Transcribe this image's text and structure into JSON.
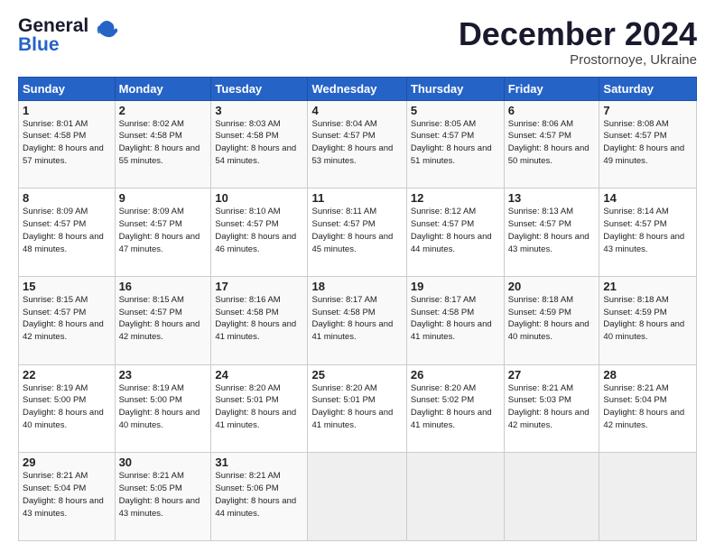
{
  "logo": {
    "line1": "General",
    "line2": "Blue"
  },
  "title": "December 2024",
  "location": "Prostornoye, Ukraine",
  "header_days": [
    "Sunday",
    "Monday",
    "Tuesday",
    "Wednesday",
    "Thursday",
    "Friday",
    "Saturday"
  ],
  "weeks": [
    [
      {
        "day": "1",
        "sunrise": "8:01 AM",
        "sunset": "4:58 PM",
        "daylight": "8 hours and 57 minutes."
      },
      {
        "day": "2",
        "sunrise": "8:02 AM",
        "sunset": "4:58 PM",
        "daylight": "8 hours and 55 minutes."
      },
      {
        "day": "3",
        "sunrise": "8:03 AM",
        "sunset": "4:58 PM",
        "daylight": "8 hours and 54 minutes."
      },
      {
        "day": "4",
        "sunrise": "8:04 AM",
        "sunset": "4:57 PM",
        "daylight": "8 hours and 53 minutes."
      },
      {
        "day": "5",
        "sunrise": "8:05 AM",
        "sunset": "4:57 PM",
        "daylight": "8 hours and 51 minutes."
      },
      {
        "day": "6",
        "sunrise": "8:06 AM",
        "sunset": "4:57 PM",
        "daylight": "8 hours and 50 minutes."
      },
      {
        "day": "7",
        "sunrise": "8:08 AM",
        "sunset": "4:57 PM",
        "daylight": "8 hours and 49 minutes."
      }
    ],
    [
      {
        "day": "8",
        "sunrise": "8:09 AM",
        "sunset": "4:57 PM",
        "daylight": "8 hours and 48 minutes."
      },
      {
        "day": "9",
        "sunrise": "8:09 AM",
        "sunset": "4:57 PM",
        "daylight": "8 hours and 47 minutes."
      },
      {
        "day": "10",
        "sunrise": "8:10 AM",
        "sunset": "4:57 PM",
        "daylight": "8 hours and 46 minutes."
      },
      {
        "day": "11",
        "sunrise": "8:11 AM",
        "sunset": "4:57 PM",
        "daylight": "8 hours and 45 minutes."
      },
      {
        "day": "12",
        "sunrise": "8:12 AM",
        "sunset": "4:57 PM",
        "daylight": "8 hours and 44 minutes."
      },
      {
        "day": "13",
        "sunrise": "8:13 AM",
        "sunset": "4:57 PM",
        "daylight": "8 hours and 43 minutes."
      },
      {
        "day": "14",
        "sunrise": "8:14 AM",
        "sunset": "4:57 PM",
        "daylight": "8 hours and 43 minutes."
      }
    ],
    [
      {
        "day": "15",
        "sunrise": "8:15 AM",
        "sunset": "4:57 PM",
        "daylight": "8 hours and 42 minutes."
      },
      {
        "day": "16",
        "sunrise": "8:15 AM",
        "sunset": "4:57 PM",
        "daylight": "8 hours and 42 minutes."
      },
      {
        "day": "17",
        "sunrise": "8:16 AM",
        "sunset": "4:58 PM",
        "daylight": "8 hours and 41 minutes."
      },
      {
        "day": "18",
        "sunrise": "8:17 AM",
        "sunset": "4:58 PM",
        "daylight": "8 hours and 41 minutes."
      },
      {
        "day": "19",
        "sunrise": "8:17 AM",
        "sunset": "4:58 PM",
        "daylight": "8 hours and 41 minutes."
      },
      {
        "day": "20",
        "sunrise": "8:18 AM",
        "sunset": "4:59 PM",
        "daylight": "8 hours and 40 minutes."
      },
      {
        "day": "21",
        "sunrise": "8:18 AM",
        "sunset": "4:59 PM",
        "daylight": "8 hours and 40 minutes."
      }
    ],
    [
      {
        "day": "22",
        "sunrise": "8:19 AM",
        "sunset": "5:00 PM",
        "daylight": "8 hours and 40 minutes."
      },
      {
        "day": "23",
        "sunrise": "8:19 AM",
        "sunset": "5:00 PM",
        "daylight": "8 hours and 40 minutes."
      },
      {
        "day": "24",
        "sunrise": "8:20 AM",
        "sunset": "5:01 PM",
        "daylight": "8 hours and 41 minutes."
      },
      {
        "day": "25",
        "sunrise": "8:20 AM",
        "sunset": "5:01 PM",
        "daylight": "8 hours and 41 minutes."
      },
      {
        "day": "26",
        "sunrise": "8:20 AM",
        "sunset": "5:02 PM",
        "daylight": "8 hours and 41 minutes."
      },
      {
        "day": "27",
        "sunrise": "8:21 AM",
        "sunset": "5:03 PM",
        "daylight": "8 hours and 42 minutes."
      },
      {
        "day": "28",
        "sunrise": "8:21 AM",
        "sunset": "5:04 PM",
        "daylight": "8 hours and 42 minutes."
      }
    ],
    [
      {
        "day": "29",
        "sunrise": "8:21 AM",
        "sunset": "5:04 PM",
        "daylight": "8 hours and 43 minutes."
      },
      {
        "day": "30",
        "sunrise": "8:21 AM",
        "sunset": "5:05 PM",
        "daylight": "8 hours and 43 minutes."
      },
      {
        "day": "31",
        "sunrise": "8:21 AM",
        "sunset": "5:06 PM",
        "daylight": "8 hours and 44 minutes."
      },
      null,
      null,
      null,
      null
    ]
  ]
}
